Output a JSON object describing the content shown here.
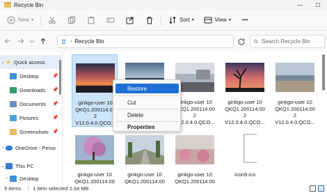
{
  "window": {
    "title": "Recycle Bin"
  },
  "toolbar": {
    "new_label": "New",
    "sort_label": "Sort",
    "view_label": "View",
    "more_label": "•••"
  },
  "address": {
    "crumb": "Recycle Bin",
    "search_placeholder": "Search Recycle Bin"
  },
  "sidebar": {
    "items": [
      {
        "label": "Quick access",
        "icon": "star-icon",
        "color": "#f2c029",
        "pinned": false
      },
      {
        "label": "Desktop",
        "icon": "desktop-folder-icon",
        "color": "#3b8ed8",
        "pinned": true
      },
      {
        "label": "Downloads",
        "icon": "downloads-folder-icon",
        "color": "#2e9e6e",
        "pinned": true
      },
      {
        "label": "Documents",
        "icon": "documents-folder-icon",
        "color": "#6b8fb3",
        "pinned": true
      },
      {
        "label": "Pictures",
        "icon": "pictures-folder-icon",
        "color": "#4aa3d8",
        "pinned": true
      },
      {
        "label": "Screenshots",
        "icon": "folder-icon",
        "color": "#e9c061",
        "pinned": true
      },
      {
        "label": "OneDrive - Perso",
        "icon": "onedrive-icon",
        "color": "#2b7cd3",
        "pinned": false
      },
      {
        "label": "This PC",
        "icon": "pc-icon",
        "color": "#3a7bd5",
        "pinned": false
      },
      {
        "label": "Desktop",
        "icon": "desktop-folder-icon",
        "color": "#3b8ed8",
        "pinned": false
      }
    ]
  },
  "files": [
    {
      "name_lines": [
        "ginkgo-user 10",
        "QKQ1.200114.00",
        "2",
        "V12.0.4.0.QCO..."
      ],
      "thumb": "sunset",
      "selected": true
    },
    {
      "name_lines": [],
      "thumb": "sky-water",
      "selected": false
    },
    {
      "name_lines": [
        "ginkgo-user 10",
        "QKQ1.200114.00",
        "2",
        "V12.0.4.0.QCO..."
      ],
      "thumb": "street",
      "selected": false
    },
    {
      "name_lines": [
        "ginkgo-user 10",
        "QKQ1.200114.00",
        "2",
        "V12.0.4.0.QCO..."
      ],
      "thumb": "tree-sunset",
      "selected": false
    },
    {
      "name_lines": [
        "ginkgo-user 10",
        "QKQ1.200114.00",
        "2",
        "V12.0.4.0.QCO..."
      ],
      "thumb": "beach",
      "selected": false
    },
    {
      "name_lines": [
        "ginkgo-user 10",
        "QKQ1.200114.00"
      ],
      "thumb": "blossom",
      "selected": false
    },
    {
      "name_lines": [
        "ginkgo-user 10",
        "QKQ1.200114.00"
      ],
      "thumb": "road",
      "selected": false
    },
    {
      "name_lines": [
        "ginkgo-user 10",
        "QKQ1.200114.00"
      ],
      "thumb": "pink-field",
      "selected": false
    },
    {
      "name_lines": [
        "Icon9.ico"
      ],
      "thumb": "blank-file",
      "selected": false
    }
  ],
  "context_menu": {
    "items": [
      {
        "label": "Restore",
        "hover": true,
        "bold": false
      },
      {
        "label": "Cut",
        "hover": false,
        "bold": false
      },
      {
        "label": "Delete",
        "hover": false,
        "bold": false
      },
      {
        "label": "Properties",
        "hover": false,
        "bold": true
      }
    ]
  },
  "status": {
    "item_count": "9 items",
    "selection": "1 item selected  2.64 MB"
  }
}
